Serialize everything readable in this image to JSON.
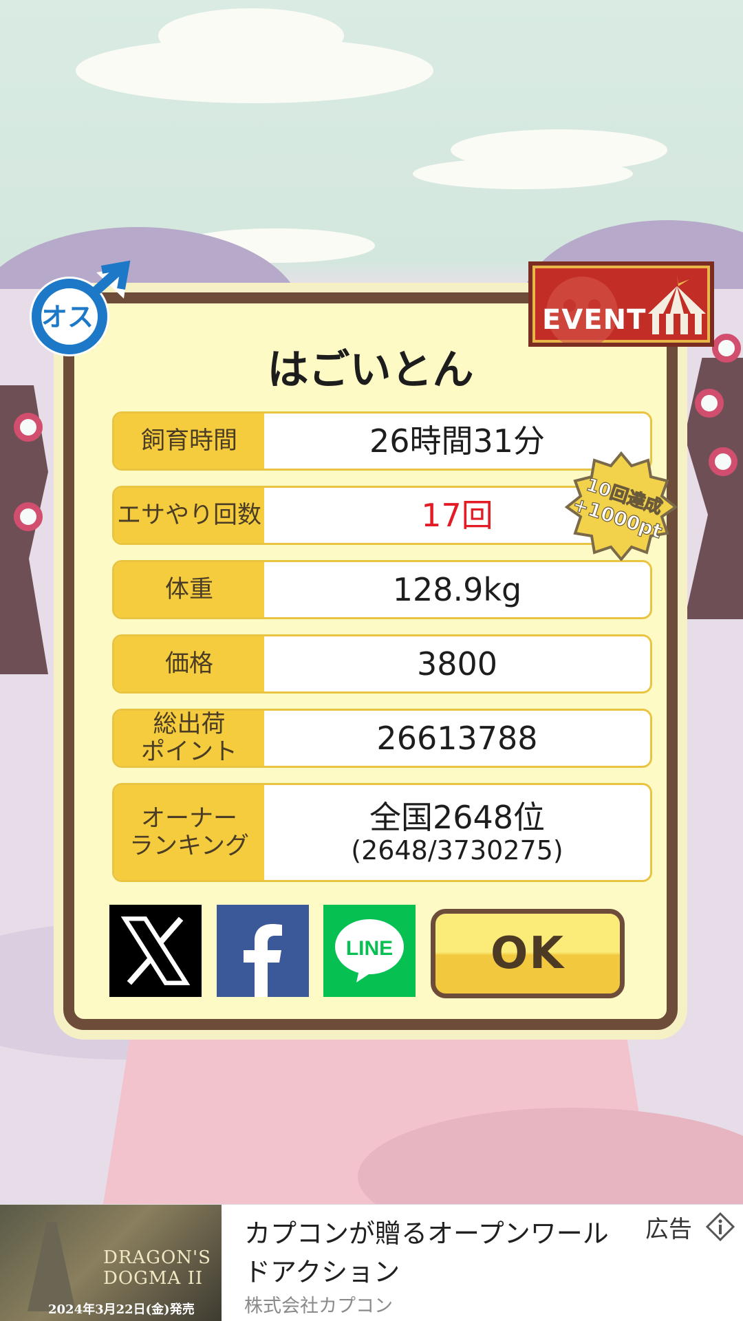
{
  "pig": {
    "name": "はごいとん",
    "gender_label": "オス"
  },
  "stats": [
    {
      "label": "飼育時間",
      "value": "26時間31分"
    },
    {
      "label": "エサやり回数",
      "value": "17回"
    },
    {
      "label": "体重",
      "value": "128.9kg"
    },
    {
      "label": "価格",
      "value": "3800"
    },
    {
      "label": "総出荷\nポイント",
      "value": "26613788"
    },
    {
      "label": "オーナー\nランキング",
      "value": "全国2648位",
      "sub": "(2648/3730275)"
    }
  ],
  "event_label": "EVENT",
  "badge": {
    "line1": "10回達成",
    "line2": "+1000pt"
  },
  "share": {
    "line_label": "LINE"
  },
  "ok_label": "OK",
  "ad": {
    "title": "カプコンが贈るオープンワールドアクション",
    "advertiser": "株式会社カプコン",
    "label": "広告",
    "image_logo": "DRAGON'S DOGMA II",
    "image_date": "2024年3月22日(金)発売"
  },
  "colors": {
    "panel_bg": "#fefac5",
    "panel_border": "#6e4c3a",
    "label_bg": "#f4cc3e",
    "count_value": "#e21b24",
    "event_bg": "#c22e26",
    "facebook": "#3b5998",
    "line": "#06c152"
  }
}
